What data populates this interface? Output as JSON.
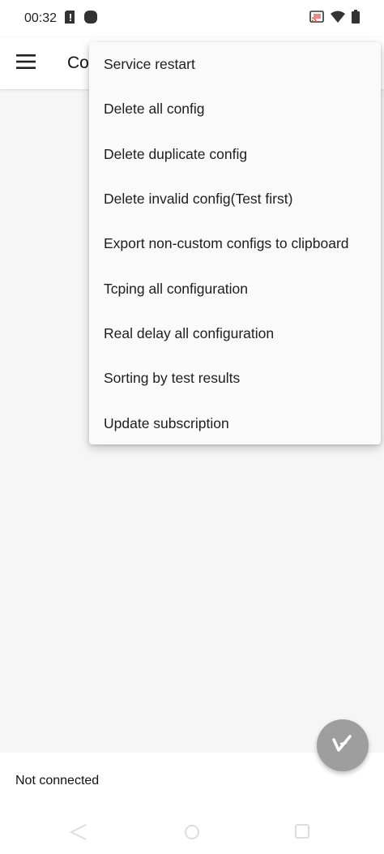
{
  "status_bar": {
    "time": "00:32",
    "left_icons": [
      "alert-card-icon",
      "app-circle-icon"
    ],
    "right_icons": [
      "cast-icon",
      "wifi-icon",
      "battery-icon"
    ]
  },
  "app_bar": {
    "title": "Co",
    "menu_icon": "hamburger-icon"
  },
  "overflow_menu": {
    "items": [
      "Service restart",
      "Delete all config",
      "Delete duplicate config",
      "Delete invalid config(Test first)",
      "Export non-custom configs to clipboard",
      "Tcping all configuration",
      "Real delay all configuration",
      "Sorting by test results",
      "Update subscription"
    ]
  },
  "connection": {
    "status_text": "Not connected"
  },
  "fab": {
    "icon": "v-logo-icon",
    "color": "#9e9e9e"
  },
  "nav_bar": {
    "buttons": [
      "back-icon",
      "home-icon",
      "recents-icon"
    ]
  },
  "colors": {
    "content_bg": "#f6f6f6",
    "menu_bg": "#fafafa",
    "fab": "#9e9e9e"
  }
}
